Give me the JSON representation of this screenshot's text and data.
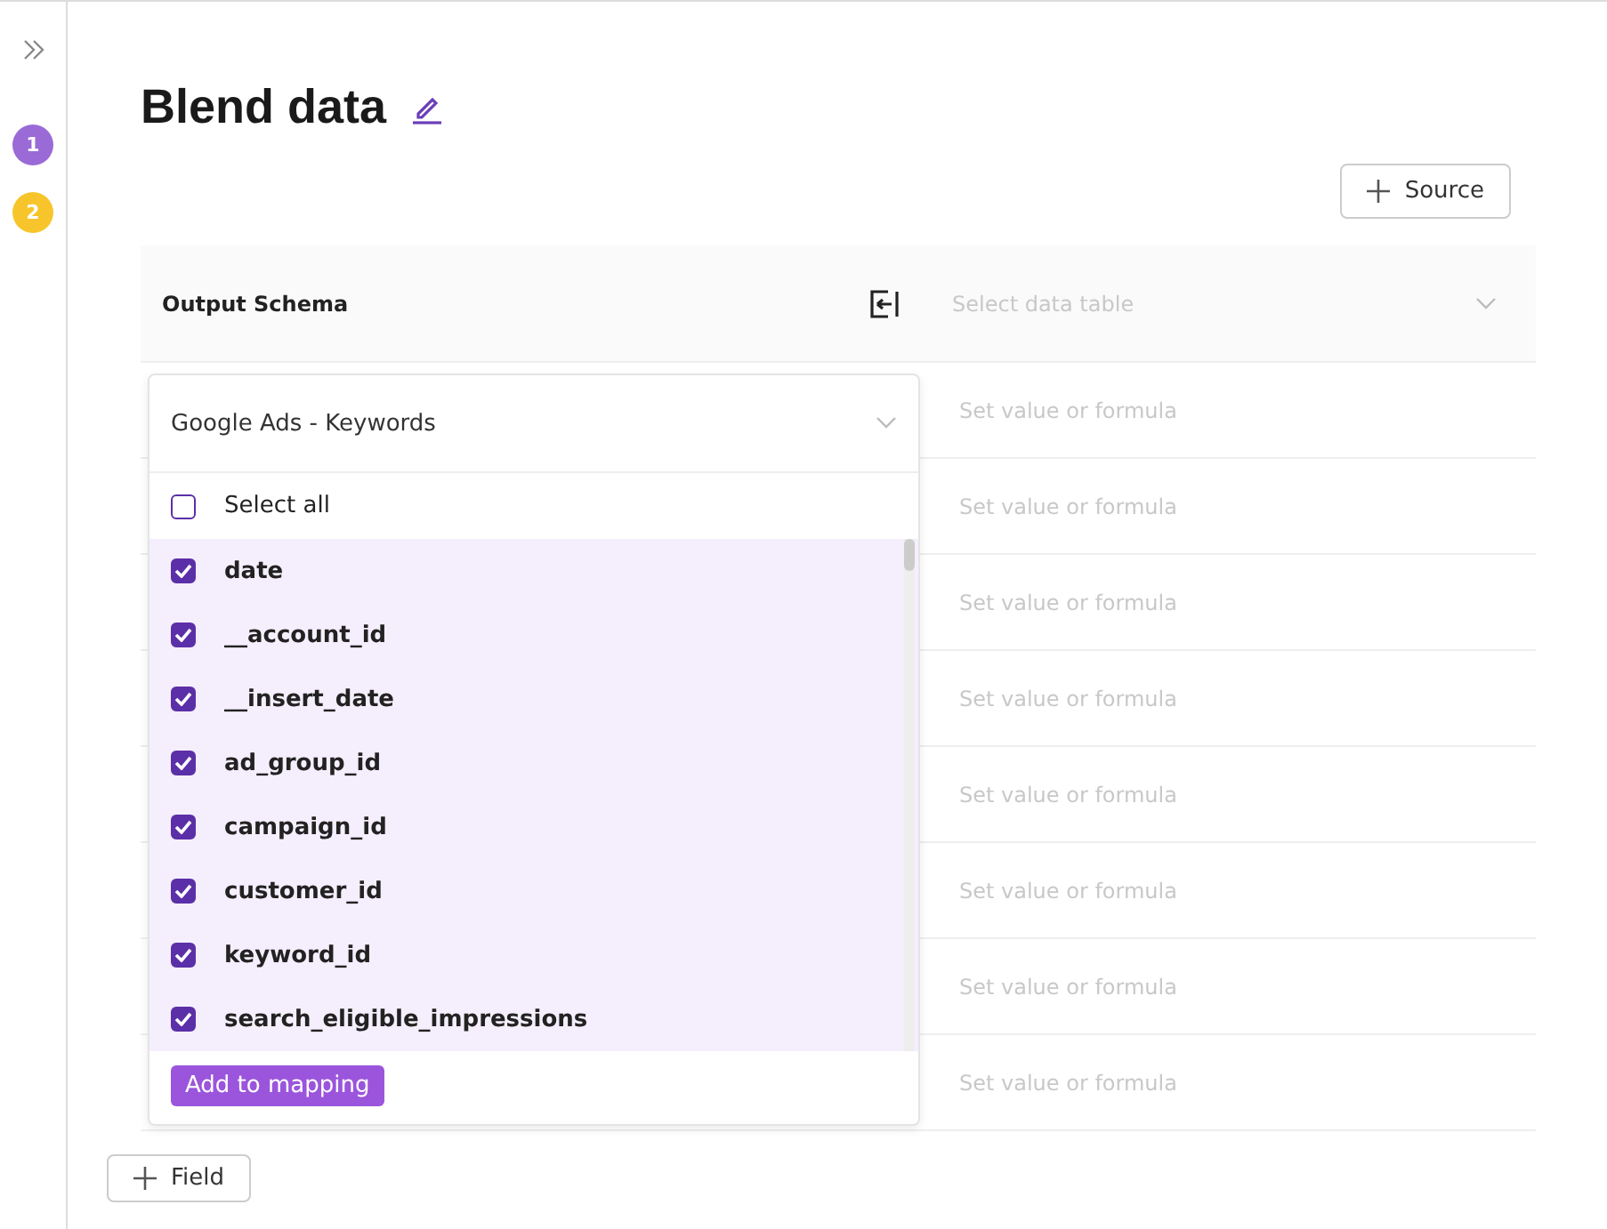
{
  "sidebar": {
    "steps": [
      {
        "label": "1",
        "color": "#9a6ad6"
      },
      {
        "label": "2",
        "color": "#f7c52b"
      }
    ]
  },
  "title": "Blend data",
  "source_button": "Source",
  "table": {
    "header": {
      "label": "Output Schema",
      "select": {
        "placeholder": "Select data table"
      }
    },
    "rows": [
      {
        "placeholder": "Set value or formula"
      },
      {
        "placeholder": "Set value or formula"
      },
      {
        "placeholder": "Set value or formula"
      },
      {
        "placeholder": "Set value or formula"
      },
      {
        "placeholder": "Set value or formula"
      },
      {
        "placeholder": "Set value or formula"
      },
      {
        "placeholder": "Set value or formula"
      },
      {
        "placeholder": "Set value or formula"
      }
    ]
  },
  "dropdown": {
    "value": "Google Ads - Keywords",
    "select_all": {
      "label": "Select all",
      "checked": false
    },
    "fields": [
      {
        "label": "date",
        "checked": true
      },
      {
        "label": "__account_id",
        "checked": true
      },
      {
        "label": "__insert_date",
        "checked": true
      },
      {
        "label": "ad_group_id",
        "checked": true
      },
      {
        "label": "campaign_id",
        "checked": true
      },
      {
        "label": "customer_id",
        "checked": true
      },
      {
        "label": "keyword_id",
        "checked": true
      },
      {
        "label": "search_eligible_impressions",
        "checked": true
      }
    ],
    "action": "Add to mapping"
  },
  "field_button": "Field"
}
